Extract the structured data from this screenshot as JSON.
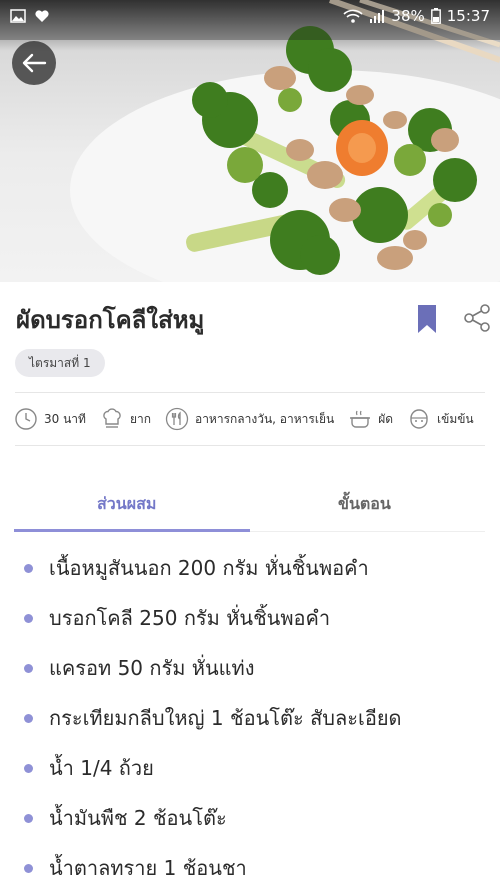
{
  "status_bar": {
    "battery": "38%",
    "time": "15:37",
    "icons": [
      "gallery-icon",
      "heart-icon",
      "wifi-icon",
      "signal-icon",
      "battery-icon"
    ]
  },
  "hero": {
    "image": "stir-fried broccoli with pork and carrot on white plate"
  },
  "recipe": {
    "title": "ผัดบรอกโคลีใส่หมู",
    "tag": "ไตรมาสที่ 1"
  },
  "info": {
    "time": "30 นาที",
    "difficulty": "ยาก",
    "meal": "อาหารกลางวัน, อาหารเย็น",
    "method": "ผัด",
    "taste": "เข้มข้น"
  },
  "tabs": {
    "ingredients": "ส่วนผสม",
    "steps": "ขั้นตอน"
  },
  "ingredients": [
    "เนื้อหมูสันนอก 200 กรัม หั่นชิ้นพอคำ",
    "บรอกโคลี 250 กรัม หั่นชิ้นพอคำ",
    "แครอท 50 กรัม หั่นแท่ง",
    "กระเทียมกลีบใหญ่ 1 ช้อนโต๊ะ สับละเอียด",
    "น้ำ 1/4 ถ้วย",
    "น้ำมันพืช 2 ช้อนโต๊ะ",
    "น้ำตาลทราย 1 ช้อนชา"
  ],
  "colors": {
    "accent": "#7478c8",
    "bullet": "#8f91d6",
    "chip_bg": "#e9e9ed"
  }
}
